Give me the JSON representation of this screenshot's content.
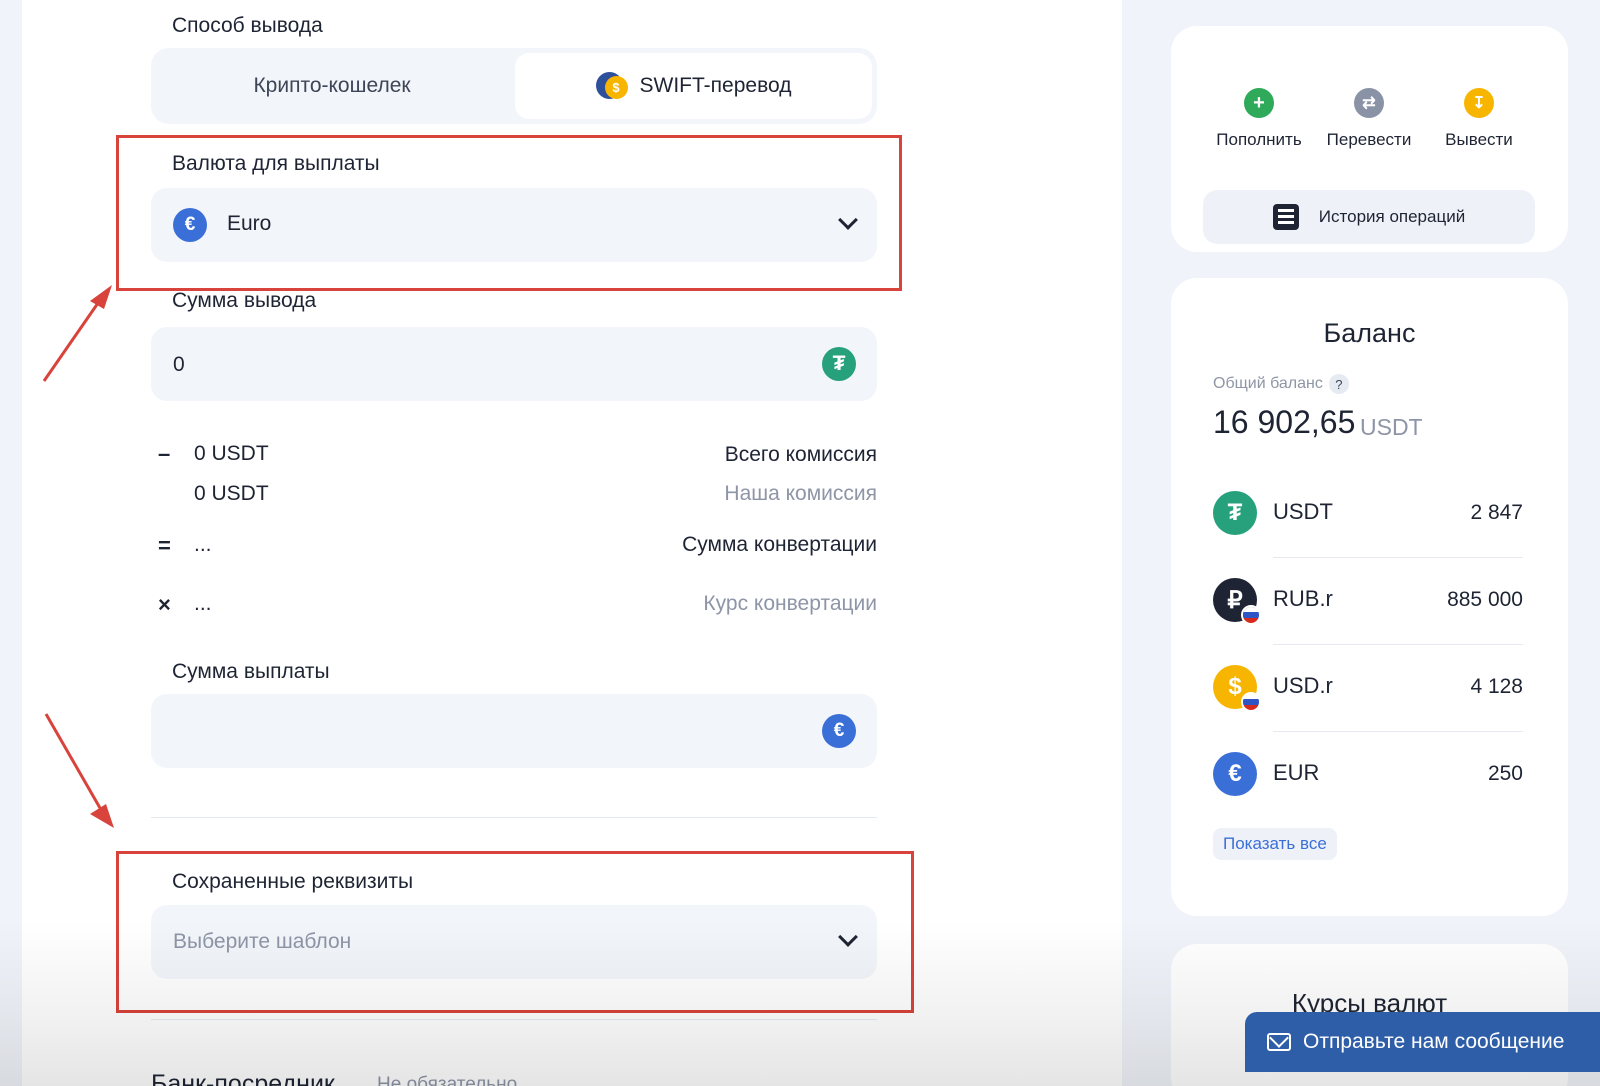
{
  "form": {
    "method_label": "Способ вывода",
    "tabs": [
      {
        "label": "Крипто-кошелек"
      },
      {
        "label": "SWIFT-перевод"
      }
    ],
    "payout_currency": {
      "label": "Валюта для выплаты",
      "value": "Euro",
      "icon": "euro-icon"
    },
    "withdraw_amount": {
      "label": "Сумма вывода",
      "value": "0",
      "icon": "usdt-icon"
    },
    "fees": {
      "total": {
        "sign": "–",
        "value": "0 USDT",
        "label": "Всего комиссия"
      },
      "ours": {
        "value": "0 USDT",
        "label": "Наша комиссия"
      },
      "conversion_sum": {
        "sign": "=",
        "value": "...",
        "label": "Сумма конвертации"
      },
      "conversion_rate": {
        "sign": "×",
        "value": "...",
        "label": "Курс конвертации"
      }
    },
    "payout_amount": {
      "label": "Сумма выплаты",
      "value": "",
      "icon": "euro-icon"
    },
    "saved_details": {
      "label": "Сохраненные реквизиты",
      "placeholder": "Выберите шаблон"
    },
    "bank_section_title": "Банк-посредник",
    "bank_section_note": "Не обязательно"
  },
  "actions": [
    {
      "label": "Пополнить",
      "icon": "plus-icon",
      "color": "#2fa95a"
    },
    {
      "label": "Перевести",
      "icon": "transfer-icon",
      "color": "#8a93a6"
    },
    {
      "label": "Вывести",
      "icon": "withdraw-icon",
      "color": "#f7b500"
    }
  ],
  "history_button": "История операций",
  "balance": {
    "title": "Баланс",
    "subtitle": "Общий баланс",
    "help": "?",
    "total": "16 902,65",
    "unit": "USDT",
    "currencies": [
      {
        "code": "USDT",
        "amount": "2 847",
        "icon": "usdt-icon",
        "color": "#26a17b"
      },
      {
        "code": "RUB.r",
        "amount": "885 000",
        "icon": "ruble-icon",
        "color": "#1e2433"
      },
      {
        "code": "USD.r",
        "amount": "4 128",
        "icon": "dollar-icon",
        "color": "#f7b500"
      },
      {
        "code": "EUR",
        "amount": "250",
        "icon": "euro-icon",
        "color": "#3b6fd8"
      }
    ],
    "show_all": "Показать все"
  },
  "rates": {
    "title": "Курсы валют"
  },
  "message_button": "Отправьте нам сообщение",
  "colors": {
    "accent": "#3b6fd8",
    "highlight_box": "#d8433b",
    "tether": "#26a17b",
    "message_button": "#2f5ea8"
  }
}
